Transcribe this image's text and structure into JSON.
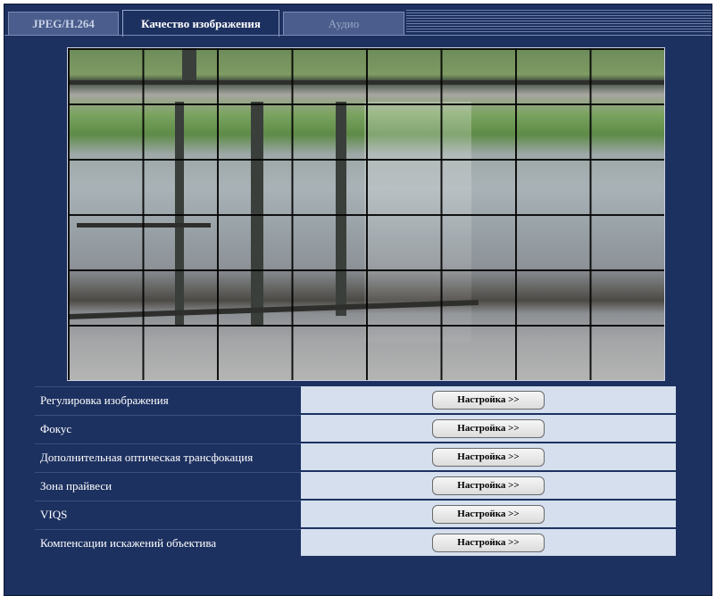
{
  "tabs": [
    {
      "label": "JPEG/H.264"
    },
    {
      "label": "Качество изображения"
    },
    {
      "label": "Аудио"
    }
  ],
  "rows": [
    {
      "label": "Регулировка изображения",
      "button": "Настройка >>"
    },
    {
      "label": "Фокус",
      "button": "Настройка >>"
    },
    {
      "label": "Дополнительная оптическая трансфокация",
      "button": "Настройка >>"
    },
    {
      "label": "Зона прайвеси",
      "button": "Настройка >>"
    },
    {
      "label": "VIQS",
      "button": "Настройка >>"
    },
    {
      "label": "Компенсации искажений объектива",
      "button": "Настройка >>"
    }
  ]
}
